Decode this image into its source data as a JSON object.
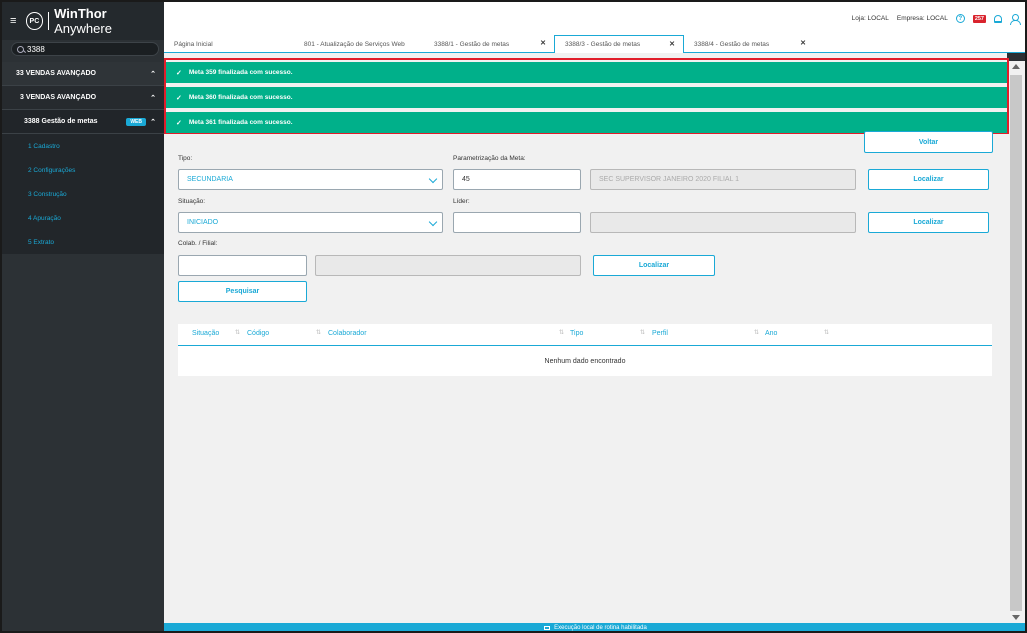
{
  "app": {
    "brand_prefix": "WinThor",
    "brand_suffix": "Anywhere",
    "logo": "PC",
    "menu_icon": "hamburger-icon"
  },
  "search": {
    "value": "3388"
  },
  "sidebar": {
    "items": [
      {
        "label": "33  VENDAS AVANÇADO"
      },
      {
        "label": "3  VENDAS AVANÇADO"
      },
      {
        "label": "3388  Gestão de metas",
        "badge": "WEB"
      }
    ],
    "sub_items": [
      {
        "label": "1  Cadastro"
      },
      {
        "label": "2  Configurações"
      },
      {
        "label": "3  Construção"
      },
      {
        "label": "4  Apuração"
      },
      {
        "label": "5  Extrato"
      }
    ]
  },
  "header": {
    "loja": "Loja: LOCAL",
    "empresa": "Empresa: LOCAL",
    "notifications": "257"
  },
  "tabs": [
    {
      "label": "Página Inicial"
    },
    {
      "label": "801 - Atualização de Serviços Web"
    },
    {
      "label": "3388/1 - Gestão de metas"
    },
    {
      "label": "3388/3 - Gestão de metas"
    },
    {
      "label": "3388/4 - Gestão de metas"
    }
  ],
  "notices": [
    "Meta 359 finalizada com sucesso.",
    "Meta 360 finalizada com sucesso.",
    "Meta 361 finalizada com sucesso."
  ],
  "form": {
    "voltar": "Voltar",
    "tipo_label": "Tipo:",
    "tipo_value": "SECUNDARIA",
    "param_label": "Parametrização da Meta:",
    "param_value": "45",
    "param_desc": "SEC SUPERVISOR JANEIRO 2020 FILIAL 1",
    "localizar": "Localizar",
    "situacao_label": "Situação:",
    "situacao_value": "INICIADO",
    "lider_label": "Líder:",
    "lider_value": "",
    "lider_desc": "",
    "colab_label": "Colab. / Filial:",
    "colab_value": "",
    "colab_desc": "",
    "pesquisar": "Pesquisar"
  },
  "table": {
    "columns": [
      "Situação",
      "Código",
      "Colaborador",
      "Tipo",
      "Perfil",
      "Ano"
    ],
    "empty": "Nenhum dado encontrado"
  },
  "status": {
    "text": "Execução local de rotina habilitada"
  },
  "colors": {
    "accent": "#1aa9d6",
    "success": "#00b08a",
    "highlight": "#e11d2a",
    "badge": "#d9232d"
  }
}
